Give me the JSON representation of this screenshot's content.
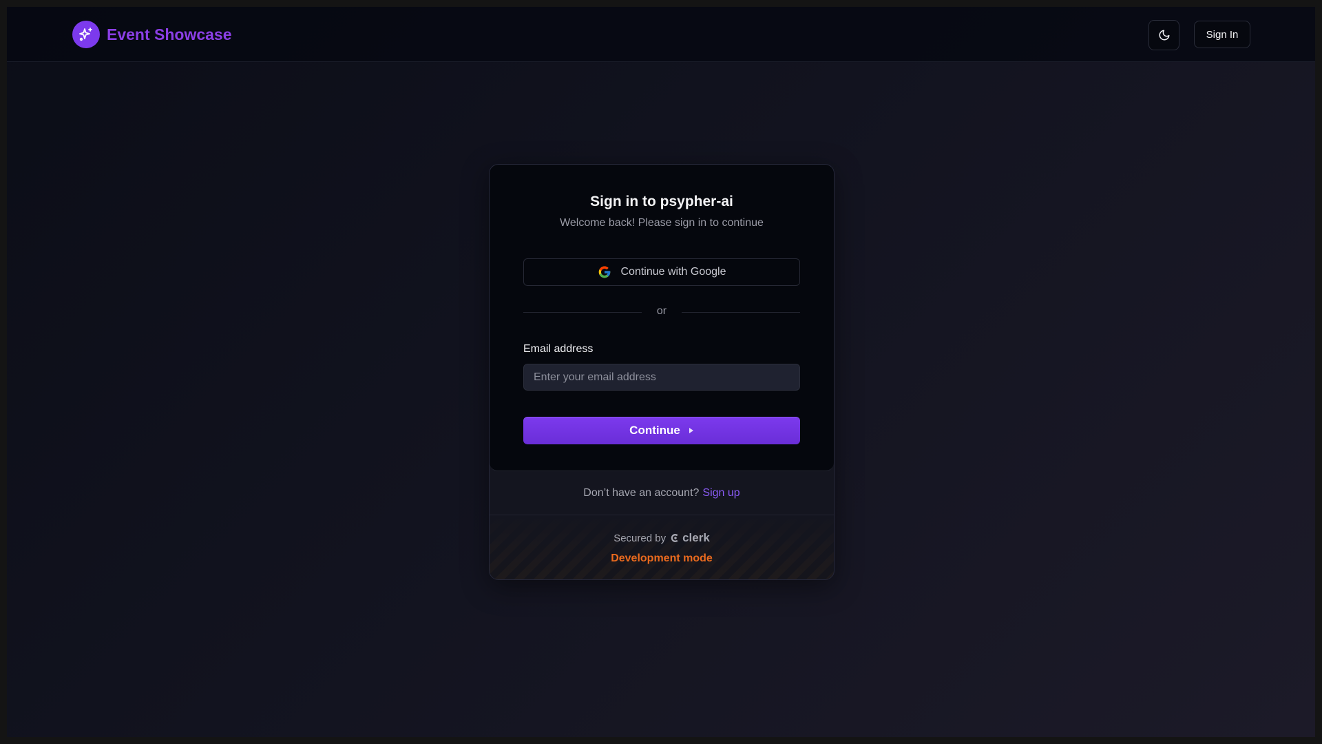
{
  "header": {
    "brand_name": "Event Showcase",
    "brand_icon": "sparkles-icon",
    "theme_icon": "moon-icon",
    "sign_in_label": "Sign In"
  },
  "signin_card": {
    "title": "Sign in to psypher-ai",
    "subtitle": "Welcome back! Please sign in to continue",
    "google_button_label": "Continue with Google",
    "divider_text": "or",
    "email_label": "Email address",
    "email_placeholder": "Enter your email address",
    "email_value": "",
    "continue_label": "Continue",
    "footer_text": "Don’t have an account?",
    "signup_link": "Sign up",
    "secured_by": "Secured by",
    "clerk_brand": "clerk",
    "dev_mode": "Development mode"
  },
  "colors": {
    "accent": "#7c3aed",
    "brand_text": "#8b3fe6",
    "dev_mode": "#ea6a1e",
    "background": "#0b0d17"
  }
}
